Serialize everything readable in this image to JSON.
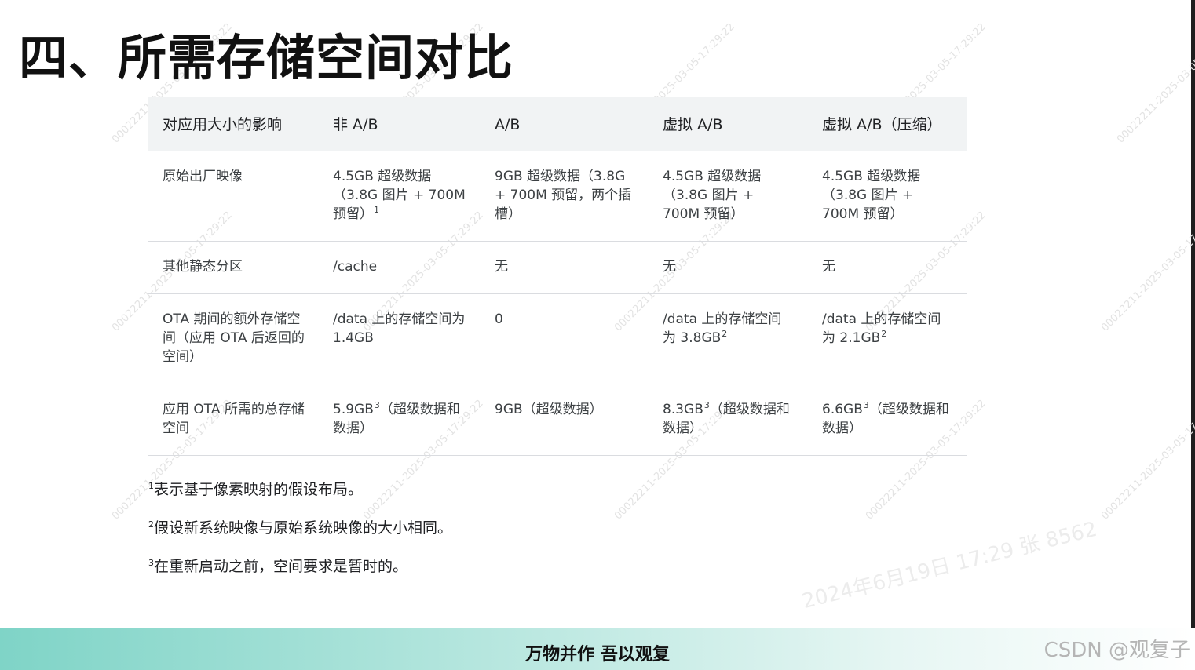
{
  "title": "四、所需存储空间对比",
  "table": {
    "headers": [
      "对应用大小的影响",
      "非 A/B",
      "A/B",
      "虚拟 A/B",
      "虚拟 A/B（压缩）"
    ],
    "rows": [
      {
        "label": "原始出厂映像",
        "cells": [
          {
            "text": "4.5GB 超级数据（3.8G 图片 + 700M 预留）",
            "sup": "1"
          },
          {
            "text": "9GB 超级数据（3.8G + 700M 预留，两个插槽）",
            "sup": ""
          },
          {
            "text": "4.5GB 超级数据（3.8G 图片 + 700M 预留）",
            "sup": ""
          },
          {
            "text": "4.5GB 超级数据（3.8G 图片 + 700M 预留）",
            "sup": ""
          }
        ]
      },
      {
        "label": "其他静态分区",
        "cells": [
          {
            "text": "/cache",
            "sup": ""
          },
          {
            "text": "无",
            "sup": ""
          },
          {
            "text": "无",
            "sup": ""
          },
          {
            "text": "无",
            "sup": ""
          }
        ]
      },
      {
        "label": "OTA 期间的额外存储空间（应用 OTA 后返回的空间）",
        "cells": [
          {
            "text": "/data 上的存储空间为 1.4GB",
            "sup": ""
          },
          {
            "text": "0",
            "sup": ""
          },
          {
            "text": "/data 上的存储空间为 3.8GB",
            "sup": "2"
          },
          {
            "text": "/data 上的存储空间为 2.1GB",
            "sup": "2"
          }
        ]
      },
      {
        "label": "应用 OTA 所需的总存储空间",
        "cells": [
          {
            "text": "5.9GB",
            "sup": "3",
            "suffix": "（超级数据和数据）"
          },
          {
            "text": "9GB（超级数据）",
            "sup": ""
          },
          {
            "text": "8.3GB",
            "sup": "3",
            "suffix": "（超级数据和数据）"
          },
          {
            "text": "6.6GB",
            "sup": "3",
            "suffix": "（超级数据和数据）"
          }
        ]
      }
    ]
  },
  "footnotes": [
    {
      "num": "1",
      "text": "表示基于像素映射的假设布局。"
    },
    {
      "num": "2",
      "text": "假设新系统映像与原始系统映像的大小相同。"
    },
    {
      "num": "3",
      "text": "在重新启动之前，空间要求是暂时的。"
    }
  ],
  "footer": {
    "slogan": "万物并作 吾以观复",
    "csdn": "CSDN @观复子"
  },
  "watermark": {
    "text": "00022211-2025-03-05-17:29:22",
    "date_text": "2024年6月19日 17:29  张 8562"
  }
}
